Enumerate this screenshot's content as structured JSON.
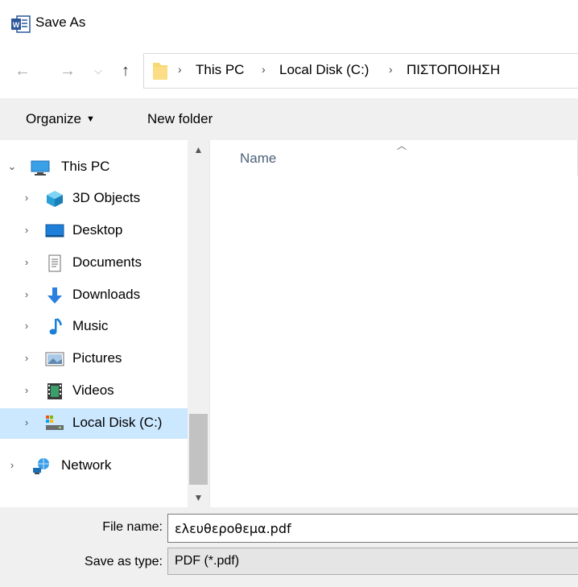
{
  "window": {
    "title": "Save As",
    "app_icon": "word-icon"
  },
  "nav": {
    "back_icon": "arrow-left-icon",
    "forward_icon": "arrow-right-icon",
    "recent_icon": "chevron-down-icon",
    "up_icon": "arrow-up-icon",
    "breadcrumb": [
      "This PC",
      "Local Disk (C:)",
      "ΠΙΣΤΟΠΟΙΗΣΗ"
    ]
  },
  "toolbar": {
    "organize_label": "Organize",
    "new_folder_label": "New folder"
  },
  "tree": {
    "items": [
      {
        "label": "This PC",
        "icon": "computer-icon"
      },
      {
        "label": "3D Objects",
        "icon": "3d-objects-icon"
      },
      {
        "label": "Desktop",
        "icon": "desktop-icon"
      },
      {
        "label": "Documents",
        "icon": "documents-icon"
      },
      {
        "label": "Downloads",
        "icon": "downloads-icon"
      },
      {
        "label": "Music",
        "icon": "music-icon"
      },
      {
        "label": "Pictures",
        "icon": "pictures-icon"
      },
      {
        "label": "Videos",
        "icon": "videos-icon"
      },
      {
        "label": "Local Disk (C:)",
        "icon": "drive-icon",
        "selected": true
      },
      {
        "label": "Network",
        "icon": "network-icon"
      }
    ]
  },
  "filelist": {
    "column_name": "Name"
  },
  "fields": {
    "file_name_label": "File name:",
    "file_name_value": "ελευθεροθεμα.pdf",
    "save_type_label": "Save as type:",
    "save_type_value": "PDF (*.pdf)"
  },
  "colors": {
    "selection": "#cce8ff",
    "toolbar_bg": "#f0f0f0",
    "header_text": "#4c607a"
  }
}
